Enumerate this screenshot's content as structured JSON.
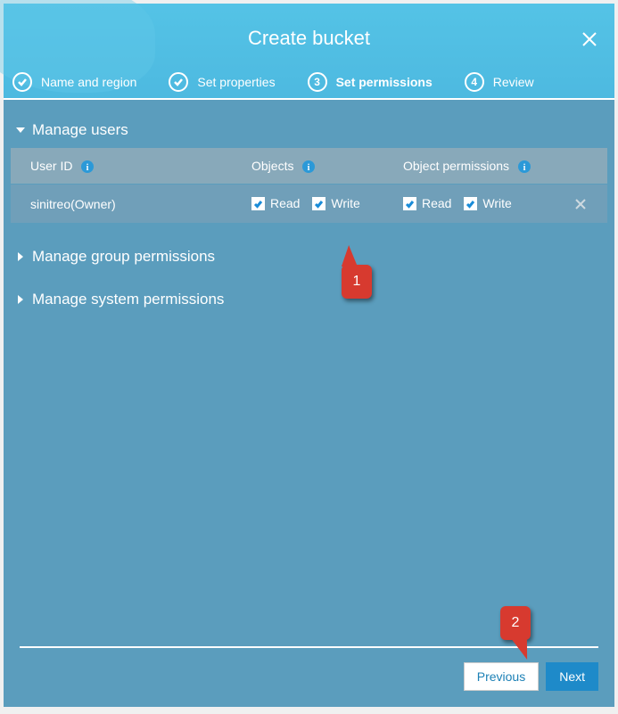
{
  "title": "Create bucket",
  "steps": {
    "s1": "Name and region",
    "s2": "Set properties",
    "s3": "Set permissions",
    "s3num": "3",
    "s4": "Review",
    "s4num": "4"
  },
  "sections": {
    "manage_users": "Manage users",
    "manage_group": "Manage group permissions",
    "manage_system": "Manage system permissions"
  },
  "table": {
    "head_user": "User ID",
    "head_objects": "Objects",
    "head_perms": "Object permissions",
    "row1_user": "sinitreo(Owner)",
    "read": "Read",
    "write": "Write"
  },
  "buttons": {
    "previous": "Previous",
    "next": "Next"
  },
  "annotations": {
    "a1": "1",
    "a2": "2"
  }
}
